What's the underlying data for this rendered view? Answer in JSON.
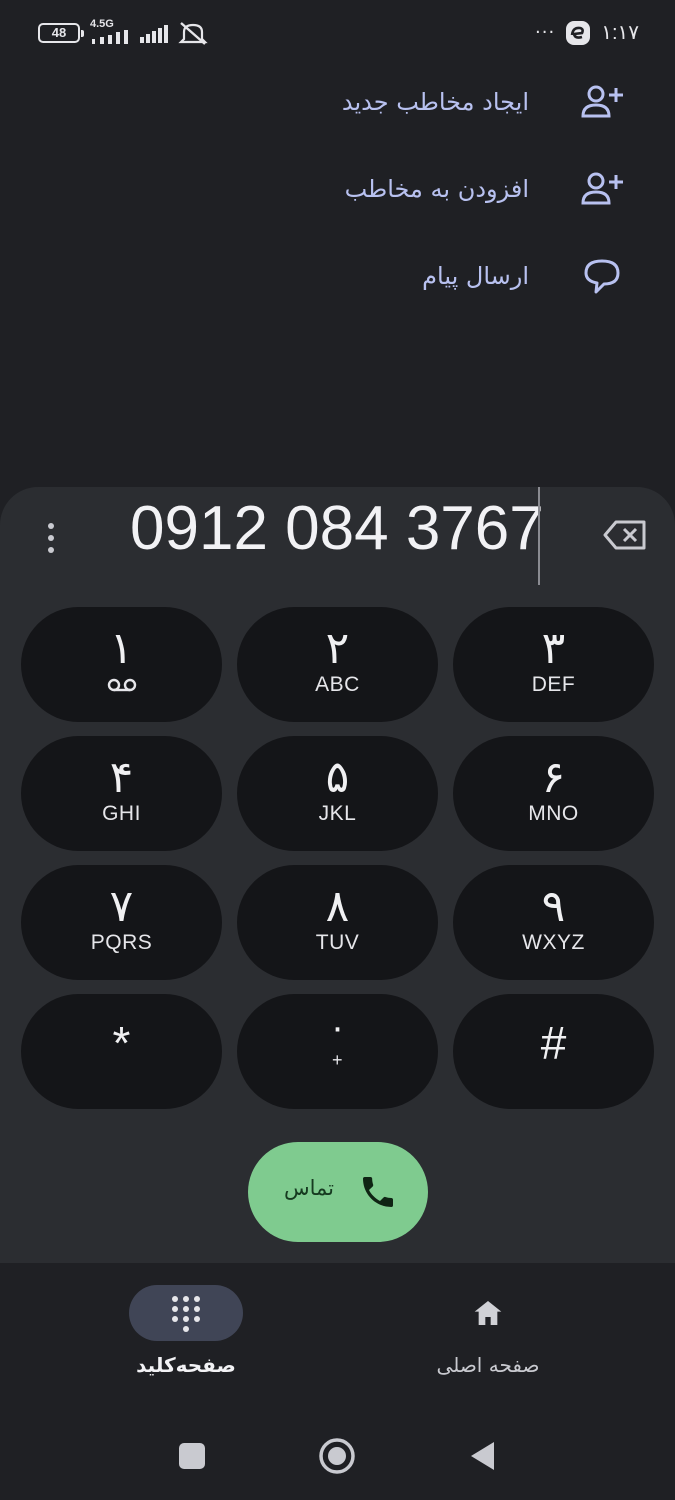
{
  "status_bar": {
    "battery": "48",
    "network_type": "4.5G",
    "overflow": "···",
    "time": "۱:۱۷"
  },
  "actions": [
    {
      "label": "ایجاد مخاطب جدید",
      "icon": "add-person-icon"
    },
    {
      "label": "افزودن به مخاطب",
      "icon": "add-person-icon"
    },
    {
      "label": "ارسال پیام",
      "icon": "message-bubble-icon"
    }
  ],
  "dialer": {
    "number": "0912 084 3767",
    "keys": [
      {
        "digit": "۱",
        "letters": ""
      },
      {
        "digit": "۲",
        "letters": "ABC"
      },
      {
        "digit": "۳",
        "letters": "DEF"
      },
      {
        "digit": "۴",
        "letters": "GHI"
      },
      {
        "digit": "۵",
        "letters": "JKL"
      },
      {
        "digit": "۶",
        "letters": "MNO"
      },
      {
        "digit": "۷",
        "letters": "PQRS"
      },
      {
        "digit": "۸",
        "letters": "TUV"
      },
      {
        "digit": "۹",
        "letters": "WXYZ"
      },
      {
        "digit": "*",
        "letters": ""
      },
      {
        "digit": "۰",
        "letters": "+"
      },
      {
        "digit": "#",
        "letters": ""
      }
    ],
    "call_label": "تماس"
  },
  "bottom_nav": {
    "keypad_label": "صفحه‌کلید",
    "home_label": "صفحه اصلی"
  },
  "colors": {
    "background": "#1f2024",
    "dialer_panel": "#2b2d31",
    "key_bg": "#141518",
    "call_green": "#7fcb8f",
    "accent_lavender": "#b8c1f0",
    "nav_active_pill": "#404556"
  }
}
